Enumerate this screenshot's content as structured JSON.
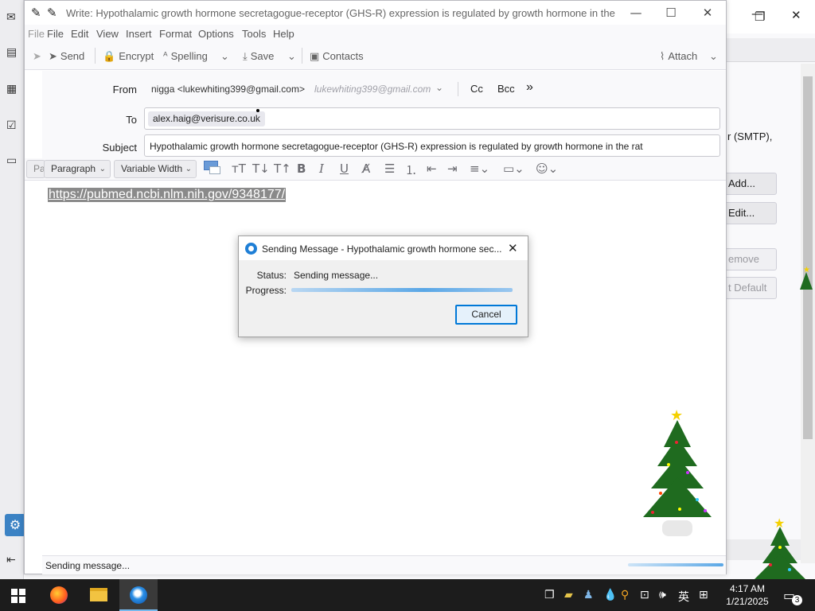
{
  "compose": {
    "title": "Write: Hypothalamic growth hormone secretagogue-receptor (GHS-R) expression is regulated by growth hormone in the rat - Th...",
    "menu": [
      "File",
      "Edit",
      "View",
      "Insert",
      "Format",
      "Options",
      "Tools",
      "Help"
    ],
    "menu_ghost": "File",
    "toolbar": {
      "send": "Send",
      "encrypt": "Encrypt",
      "spelling": "Spelling",
      "save": "Save",
      "contacts": "Contacts",
      "attach": "Attach"
    },
    "from_label": "From",
    "from_value": "nigga <lukewhiting399@gmail.com>",
    "from_identity": "lukewhiting399@gmail.com",
    "cc": "Cc",
    "bcc": "Bcc",
    "more": "»",
    "to_label": "To",
    "to_recipient": "alex.haig@verisure.co.uk",
    "subject_label": "Subject",
    "subject_value": "Hypothalamic growth hormone secretagogue-receptor (GHS-R) expression is regulated by growth hormone in the rat",
    "format_ghost": "Pa",
    "paragraph_select": "Paragraph",
    "font_select": "Variable Width",
    "body_link": "https://pubmed.ncbi.nlm.nih.gov/9348177/",
    "status_text": "Sending message..."
  },
  "dialog": {
    "title": "Sending Message - Hypothalamic growth hormone sec...",
    "status_label": "Status:",
    "status_value": "Sending message...",
    "progress_label": "Progress:",
    "cancel": "Cancel"
  },
  "background": {
    "smtp_text": "r (SMTP),",
    "add_btn": "Add...",
    "edit_btn": "Edit...",
    "remove_btn": "emove",
    "default_btn": "t Default"
  },
  "taskbar": {
    "time": "4:17 AM",
    "date": "1/21/2025",
    "ime": "英",
    "notifications": "3"
  },
  "colors": {
    "accent": "#0078d7",
    "taskbar": "#1c1c1c",
    "selection": "#8a8a8a"
  }
}
